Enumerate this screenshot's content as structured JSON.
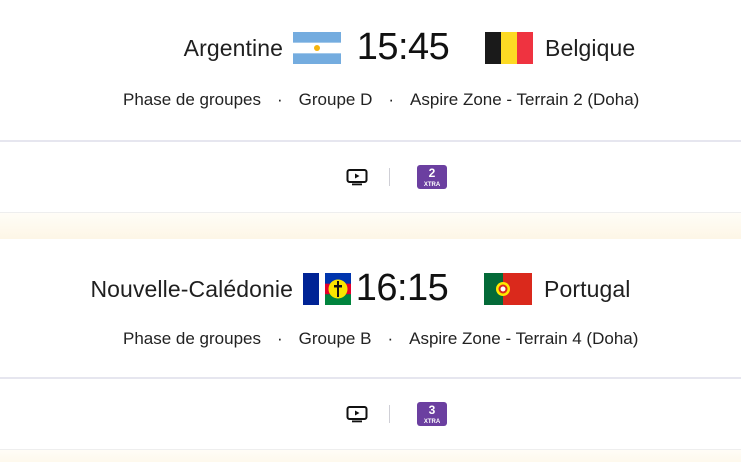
{
  "matches": [
    {
      "home_team": "Argentine",
      "home_flag": "argentina-flag",
      "kickoff": "15:45",
      "away_team": "Belgique",
      "away_flag": "belgium-flag",
      "phase": "Phase de groupes",
      "group": "Groupe D",
      "venue": "Aspire Zone - Terrain 2 (Doha)",
      "separator": "·",
      "broadcast_icon": "tv-icon",
      "channel_number": "2",
      "channel_suffix": "XTRA"
    },
    {
      "home_team": "Nouvelle-Calédonie",
      "home_flag": "new-caledonia-flag",
      "kickoff": "16:15",
      "away_team": "Portugal",
      "away_flag": "portugal-flag",
      "phase": "Phase de groupes",
      "group": "Groupe B",
      "venue": "Aspire Zone - Terrain 4 (Doha)",
      "separator": "·",
      "broadcast_icon": "tv-icon",
      "channel_number": "3",
      "channel_suffix": "XTRA"
    }
  ],
  "colors": {
    "channel_badge": "#6b3fa0",
    "divider": "#e6e6ef",
    "band_top": "#fffdf7",
    "band_bottom": "#fdf6e6"
  }
}
